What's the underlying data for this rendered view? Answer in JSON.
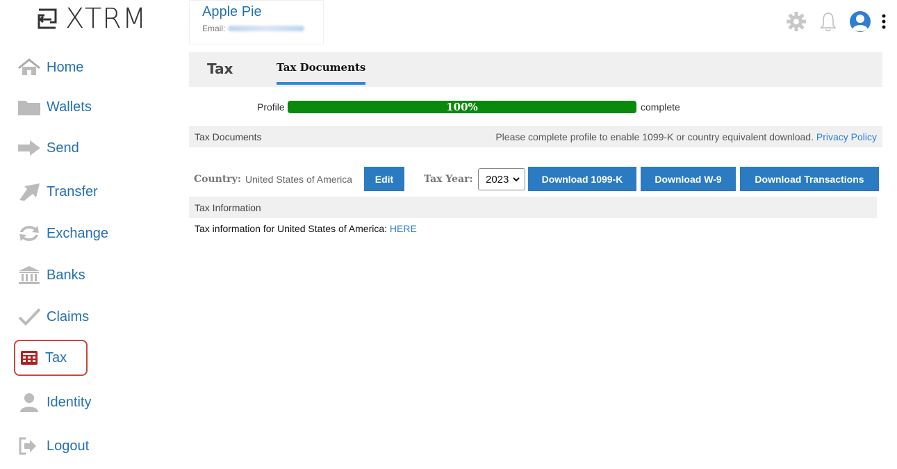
{
  "brand": {
    "name": "XTRM"
  },
  "sidebar": {
    "items": [
      {
        "label": "Home",
        "icon": "home-icon"
      },
      {
        "label": "Wallets",
        "icon": "folder-icon"
      },
      {
        "label": "Send",
        "icon": "arrow-right-icon"
      },
      {
        "label": "Transfer",
        "icon": "transfer-arrow-icon"
      },
      {
        "label": "Exchange",
        "icon": "exchange-icon"
      },
      {
        "label": "Banks",
        "icon": "bank-icon"
      },
      {
        "label": "Claims",
        "icon": "checkmark-icon"
      },
      {
        "label": "Tax",
        "icon": "calculator-icon",
        "active": true
      },
      {
        "label": "Identity",
        "icon": "user-icon"
      },
      {
        "label": "Logout",
        "icon": "logout-icon"
      }
    ]
  },
  "header": {
    "user_name": "Apple Pie",
    "email_label": "Email:",
    "icons": [
      "gear-icon",
      "bell-icon",
      "avatar-icon",
      "more-vertical-icon"
    ]
  },
  "tabs": {
    "section": "Tax",
    "active": "Tax Documents"
  },
  "profile": {
    "label": "Profile",
    "percent_text": "100%",
    "progress": 1.0,
    "suffix": "complete"
  },
  "documents": {
    "title": "Tax Documents",
    "note": "Please complete profile to enable 1099-K or country equivalent download.",
    "privacy_link": "Privacy Policy"
  },
  "controls": {
    "country_label": "Country:",
    "country_value": "United States of America",
    "edit_button": "Edit",
    "tax_year_label": "Tax Year:",
    "tax_year_value": "2023",
    "download_1099k": "Download 1099-K",
    "download_w9": "Download W-9",
    "download_transactions": "Download Transactions"
  },
  "tax_info": {
    "title": "Tax Information",
    "text": "Tax information for United States of America:",
    "link": "HERE"
  },
  "colors": {
    "accent": "#2470b3",
    "button": "#2b7bc2",
    "progress": "#0a8a0a",
    "active_outline": "#c8473d",
    "tax_icon": "#b22222"
  }
}
